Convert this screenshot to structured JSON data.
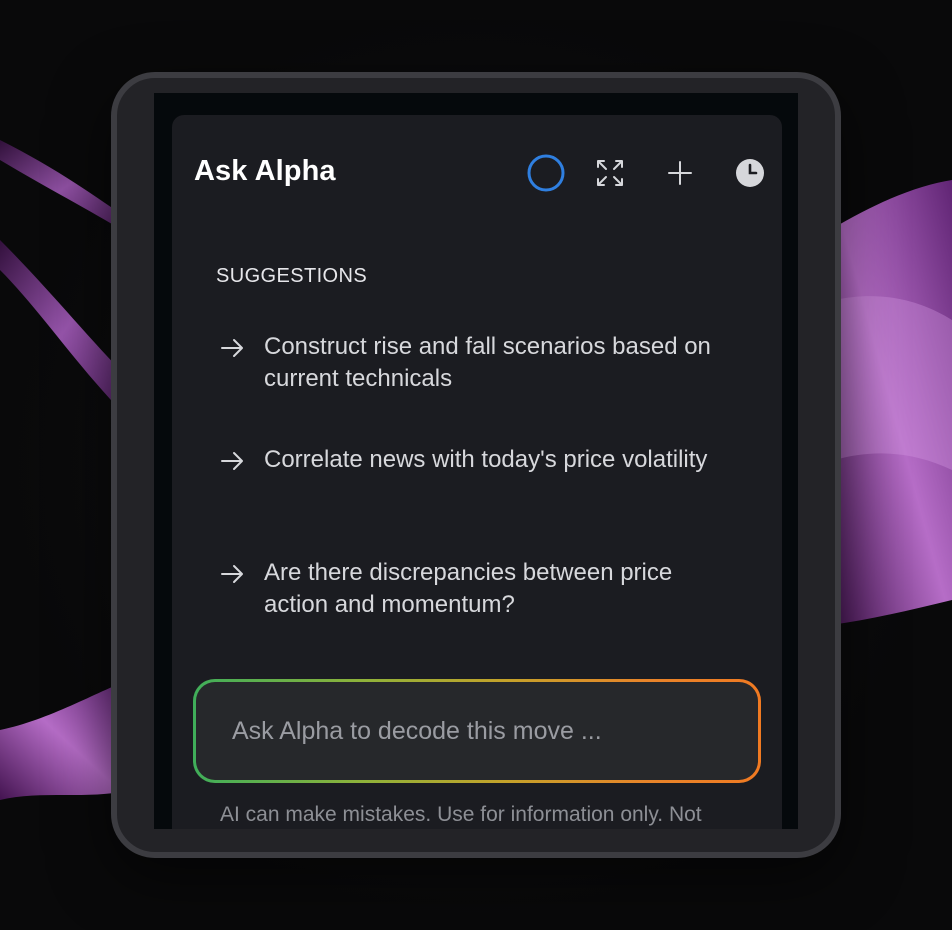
{
  "panel": {
    "title": "Ask Alpha",
    "icons": {
      "status": "loading-ring-icon",
      "expand": "expand-icon",
      "add": "plus-icon",
      "history": "clock-icon"
    }
  },
  "suggestions": {
    "heading": "SUGGESTIONS",
    "items": [
      {
        "text": "Construct rise and fall scenarios based on current technicals"
      },
      {
        "text": "Correlate news with today's price volatility"
      },
      {
        "text": "Are there discrepancies between price action and momentum?"
      }
    ]
  },
  "composer": {
    "placeholder": "Ask Alpha to decode this move ..."
  },
  "disclaimer": "AI can make mistakes. Use for information only. Not",
  "colors": {
    "accent_blue": "#2f7fe0",
    "gradient_start": "#3fae5a",
    "gradient_end": "#f07a22",
    "panel_bg": "#1b1c21"
  }
}
